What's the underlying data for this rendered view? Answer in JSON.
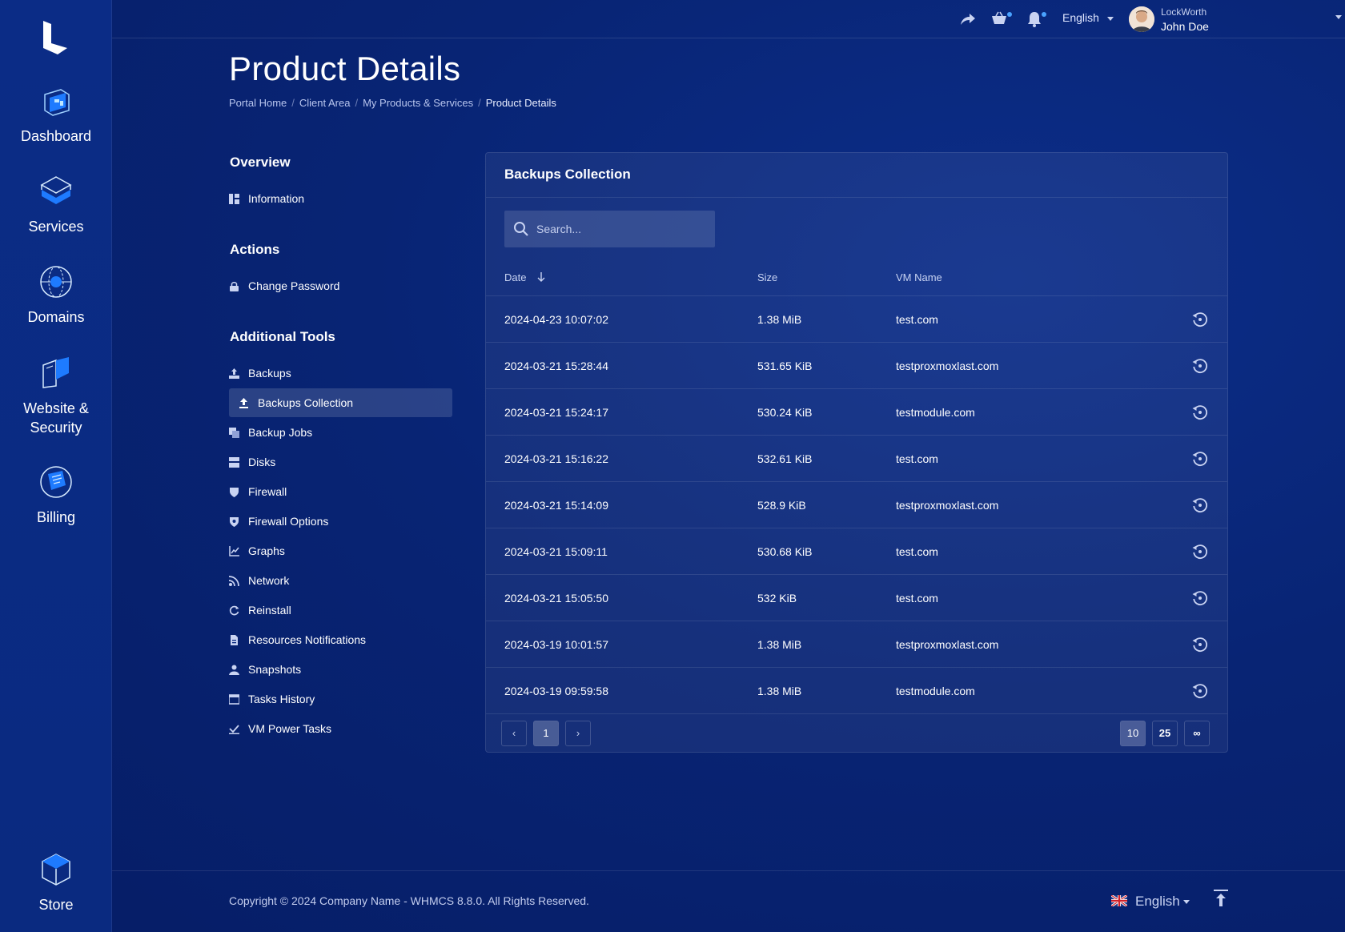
{
  "rail": {
    "items": [
      {
        "label": "Dashboard",
        "icon": "dashboard-icon"
      },
      {
        "label": "Services",
        "icon": "services-icon"
      },
      {
        "label": "Domains",
        "icon": "domains-icon"
      },
      {
        "label": "Website &",
        "label2": "Security",
        "icon": "website-security-icon"
      },
      {
        "label": "Billing",
        "icon": "billing-icon"
      },
      {
        "label": "Store",
        "icon": "store-icon"
      }
    ]
  },
  "topbar": {
    "language": "English",
    "company": "LockWorth",
    "user": "John Doe"
  },
  "header": {
    "title": "Product Details",
    "breadcrumb": [
      "Portal Home",
      "Client Area",
      "My Products & Services",
      "Product Details"
    ]
  },
  "sidebar": {
    "overview_title": "Overview",
    "overview_items": [
      "Information"
    ],
    "actions_title": "Actions",
    "actions_items": [
      "Change Password"
    ],
    "tools_title": "Additional Tools",
    "tools_items": [
      "Backups",
      "Backups Collection",
      "Backup Jobs",
      "Disks",
      "Firewall",
      "Firewall Options",
      "Graphs",
      "Network",
      "Reinstall",
      "Resources Notifications",
      "Snapshots",
      "Tasks History",
      "VM Power Tasks"
    ],
    "active_item": "Backups Collection"
  },
  "card": {
    "title": "Backups Collection",
    "search_placeholder": "Search...",
    "columns": {
      "date": "Date",
      "size": "Size",
      "vm": "VM Name"
    },
    "rows": [
      {
        "date": "2024-04-23 10:07:02",
        "size": "1.38 MiB",
        "vm": "test.com"
      },
      {
        "date": "2024-03-21 15:28:44",
        "size": "531.65 KiB",
        "vm": "testproxmoxlast.com"
      },
      {
        "date": "2024-03-21 15:24:17",
        "size": "530.24 KiB",
        "vm": "testmodule.com"
      },
      {
        "date": "2024-03-21 15:16:22",
        "size": "532.61 KiB",
        "vm": "test.com"
      },
      {
        "date": "2024-03-21 15:14:09",
        "size": "528.9 KiB",
        "vm": "testproxmoxlast.com"
      },
      {
        "date": "2024-03-21 15:09:11",
        "size": "530.68 KiB",
        "vm": "test.com"
      },
      {
        "date": "2024-03-21 15:05:50",
        "size": "532 KiB",
        "vm": "test.com"
      },
      {
        "date": "2024-03-19 10:01:57",
        "size": "1.38 MiB",
        "vm": "testproxmoxlast.com"
      },
      {
        "date": "2024-03-19 09:59:58",
        "size": "1.38 MiB",
        "vm": "testmodule.com"
      }
    ],
    "pagination": {
      "prev": "‹",
      "current": "1",
      "next": "›"
    },
    "page_sizes": [
      "10",
      "25",
      "∞"
    ],
    "selected_page_size": "10"
  },
  "footer": {
    "copyright": "Copyright © 2024 Company Name - WHMCS 8.8.0. All Rights Reserved.",
    "language": "English"
  },
  "colors": {
    "background": "#082474",
    "rail": "#0a2a80",
    "accent": "#4aa3ff"
  }
}
